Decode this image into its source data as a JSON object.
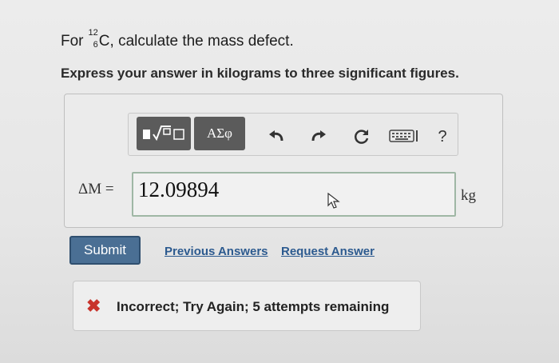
{
  "question": {
    "prefix": "For ",
    "mass_number": "12",
    "atomic_number": "6",
    "element": "C",
    "suffix": ", calculate the mass defect.",
    "instruction": "Express your answer in kilograms to three significant figures."
  },
  "toolbar": {
    "templates_icon": "templates-icon",
    "symbols_label": "ΑΣφ",
    "undo_icon": "undo-icon",
    "redo_icon": "redo-icon",
    "reset_icon": "reset-icon",
    "keyboard_icon": "keyboard-icon",
    "help_label": "?"
  },
  "answer": {
    "label": "ΔM =",
    "value": "12.09894",
    "unit": "kg"
  },
  "actions": {
    "submit": "Submit",
    "previous_answers": "Previous Answers",
    "request_answer": "Request Answer"
  },
  "feedback": {
    "icon": "✖",
    "message": "Incorrect; Try Again; 5 attempts remaining"
  },
  "colors": {
    "submit_bg": "#4a6f94",
    "link": "#2c5a8f",
    "error": "#c8342c"
  }
}
